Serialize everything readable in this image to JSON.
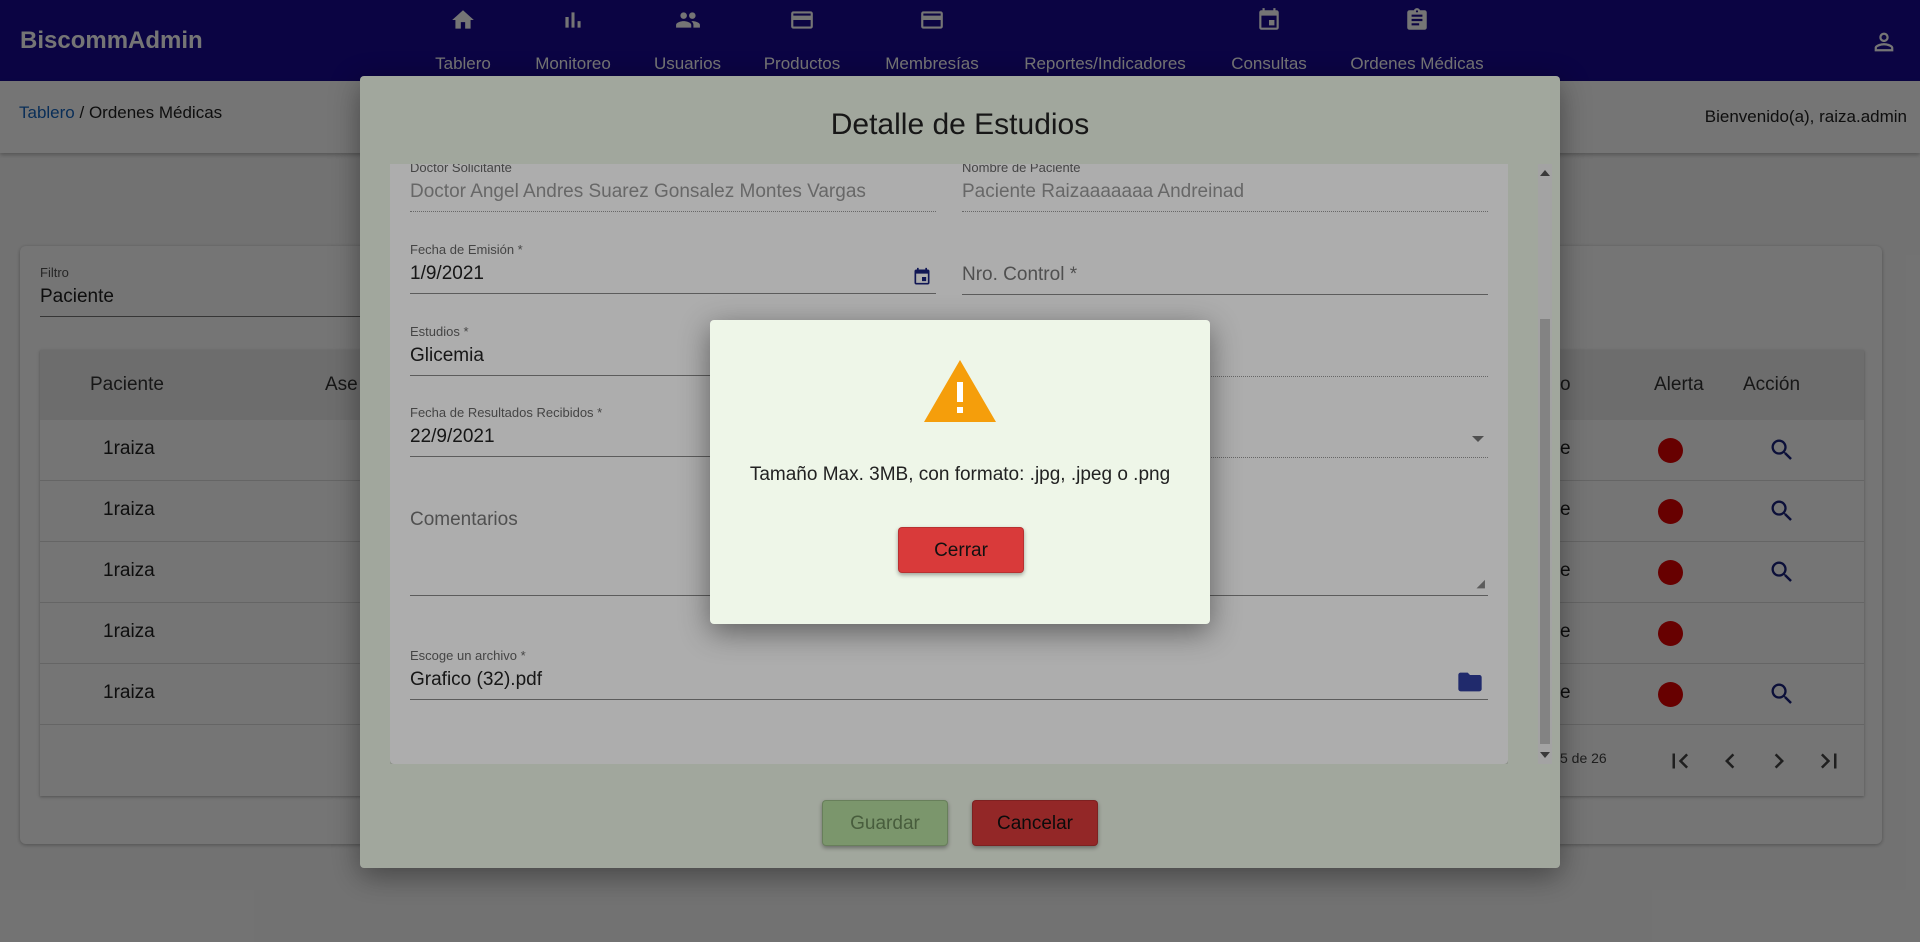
{
  "app": {
    "title": "BiscommAdmin"
  },
  "nav": {
    "items": [
      {
        "label": "Tablero",
        "icon": "home-icon"
      },
      {
        "label": "Monitoreo",
        "icon": "bar-chart-icon"
      },
      {
        "label": "Usuarios",
        "icon": "people-icon"
      },
      {
        "label": "Productos",
        "icon": "credit-card-icon"
      },
      {
        "label": "Membresías",
        "icon": "credit-card-icon"
      },
      {
        "label": "Reportes/Indicadores",
        "icon": ""
      },
      {
        "label": "Consultas",
        "icon": "calendar-icon"
      },
      {
        "label": "Ordenes Médicas",
        "icon": "clipboard-icon"
      }
    ],
    "user_icon": "account-icon"
  },
  "breadcrumb": {
    "home": "Tablero",
    "separator": " / ",
    "current": "Ordenes Médicas"
  },
  "welcome": "Bienvenido(a), raiza.admin",
  "filter": {
    "label": "Filtro",
    "value": "Paciente"
  },
  "table": {
    "headers": {
      "patient": "Paciente",
      "partial": "Ase",
      "partial_end": "o",
      "alert": "Alerta",
      "action": "Acción"
    },
    "rows": [
      {
        "patient": "1raiza",
        "partial": "e",
        "has_action": true
      },
      {
        "patient": "1raiza",
        "partial": "e",
        "has_action": true
      },
      {
        "patient": "1raiza",
        "partial": "e",
        "has_action": true
      },
      {
        "patient": "1raiza",
        "partial": "e",
        "has_action": false
      },
      {
        "patient": "1raiza",
        "partial": "e",
        "has_action": true
      }
    ],
    "range": "5 de 26",
    "alert_color": "#e00000"
  },
  "detail_dialog": {
    "title": "Detalle de Estudios",
    "doctor": {
      "label": "Doctor Solicitante",
      "value": "Doctor Angel Andres Suarez Gonsalez Montes Vargas"
    },
    "patient": {
      "label": "Nombre de Paciente",
      "value": "Paciente Raizaaaaaaa Andreinad"
    },
    "emission_date": {
      "label": "Fecha de Emisión *",
      "value": "1/9/2021"
    },
    "control_number": {
      "placeholder": "Nro. Control *"
    },
    "studies": {
      "label": "Estudios *",
      "value": "Glicemia"
    },
    "results_date": {
      "label": "Fecha de Resultados Recibidos *",
      "value": "22/9/2021"
    },
    "comments": {
      "placeholder": "Comentarios"
    },
    "file": {
      "label": "Escoge un archivo *",
      "value": "Grafico (32).pdf"
    },
    "save_label": "Guardar",
    "cancel_label": "Cancelar"
  },
  "alert_dialog": {
    "icon": "warning-icon",
    "message": "Tamaño Max. 3MB, con formato: .jpg, .jpeg o .png",
    "close_label": "Cerrar",
    "warning_color": "#f59e0b"
  },
  "colors": {
    "navbar": "#1a0a94",
    "danger": "#d93a3a",
    "success_disabled": "#b5dd9f"
  }
}
